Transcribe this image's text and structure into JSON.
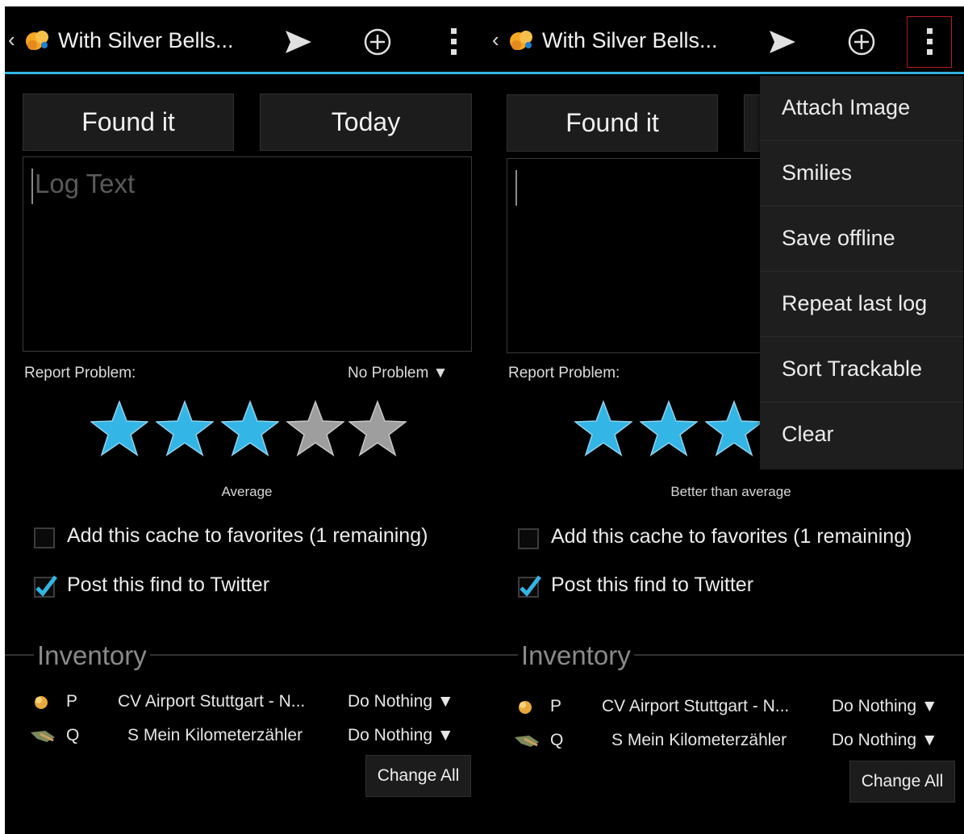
{
  "screens": [
    {
      "title": "With Silver Bells...",
      "log_type": "Found it",
      "date": "Today",
      "log_text_placeholder": "Log Text",
      "report_problem_label": "Report Problem:",
      "report_problem_value": "No Problem ▼",
      "rating": {
        "stars_filled": 3,
        "stars_total": 5,
        "label": "Average"
      },
      "checkboxes": [
        {
          "label": "Add this cache to favorites (1 remaining)",
          "checked": false
        },
        {
          "label": "Post this find to Twitter",
          "checked": true
        }
      ],
      "inventory_title": "Inventory",
      "inventory": [
        {
          "code": "P",
          "name": "CV Airport Stuttgart - N...",
          "action": "Do Nothing ▼"
        },
        {
          "code": "Q",
          "name": "S Mein Kilometerzähler",
          "action": "Do Nothing ▼"
        }
      ],
      "change_all_label": "Change All"
    },
    {
      "title": "With Silver Bells...",
      "log_type": "Found it",
      "log_text_placeholder": "",
      "report_problem_label": "Report Problem:",
      "rating": {
        "stars_filled": 3,
        "stars_total": 5,
        "label": "Better than average"
      },
      "checkboxes": [
        {
          "label": "Add this cache to favorites (1 remaining)",
          "checked": false
        },
        {
          "label": "Post this find to Twitter",
          "checked": true
        }
      ],
      "inventory_title": "Inventory",
      "inventory": [
        {
          "code": "P",
          "name": "CV Airport Stuttgart - N...",
          "action": "Do Nothing ▼"
        },
        {
          "code": "Q",
          "name": "S Mein Kilometerzähler",
          "action": "Do Nothing ▼"
        }
      ],
      "change_all_label": "Change All",
      "overflow_menu": [
        "Attach Image",
        "Smilies",
        "Save offline",
        "Repeat last log",
        "Sort Trackable",
        "Clear"
      ]
    }
  ],
  "icons": {
    "back": "‹",
    "send": "send-icon",
    "add": "add-circle-icon",
    "more": "more-vert-icon"
  },
  "colors": {
    "accent": "#33b5e5",
    "star_filled": "#33b5e5",
    "star_empty": "#9e9e9e",
    "menu_highlight_border": "#b71c1c"
  }
}
